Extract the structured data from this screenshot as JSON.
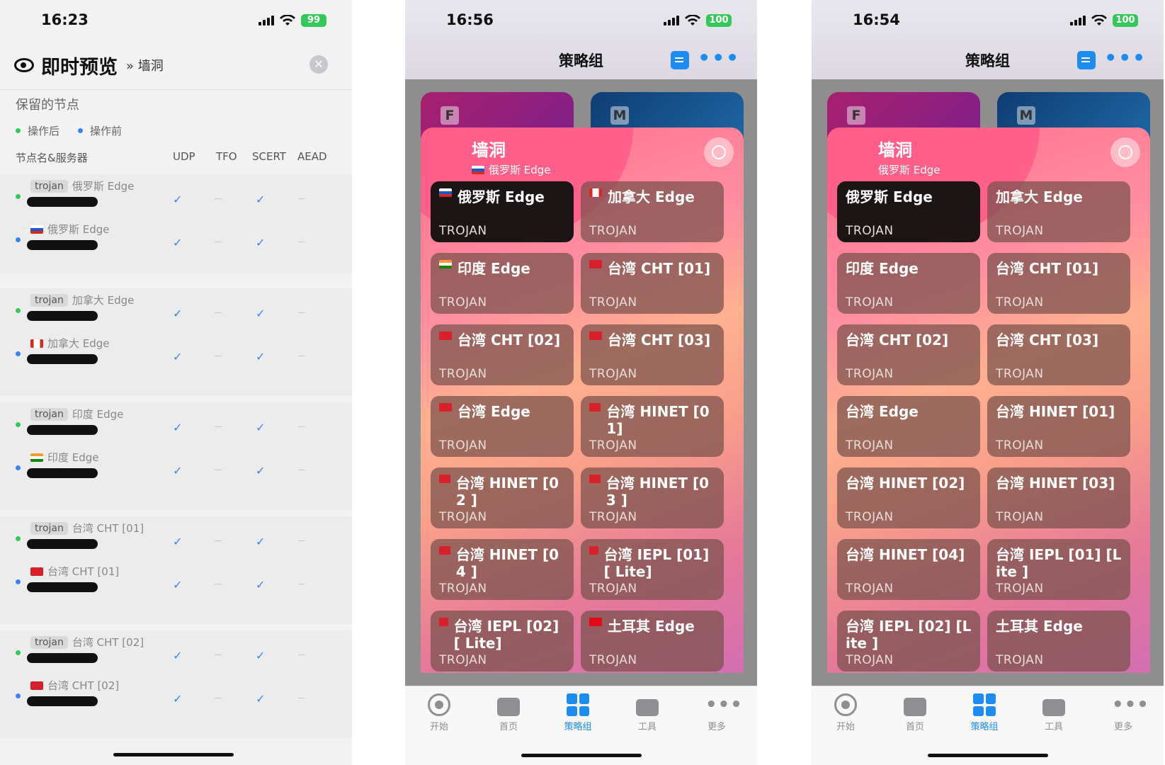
{
  "phone1": {
    "time": "16:23",
    "battery": "99",
    "title": "即时预览",
    "breadcrumb": "墙洞",
    "section": "保留的节点",
    "legend_after": "操作后",
    "legend_before": "操作前",
    "columns": [
      "节点名&服务器",
      "UDP",
      "TFO",
      "SCERT",
      "AEAD"
    ],
    "tag": "trojan",
    "groups": [
      {
        "name": "俄罗斯 Edge",
        "flag": "ru"
      },
      {
        "name": "加拿大 Edge",
        "flag": "ca"
      },
      {
        "name": "印度 Edge",
        "flag": "in"
      },
      {
        "name": "台湾 CHT [01]",
        "flag": "tw"
      },
      {
        "name": "台湾 CHT [02]",
        "flag": "tw"
      }
    ]
  },
  "phone2": {
    "time": "16:56",
    "battery": "100",
    "title": "策略组",
    "bg_letters": [
      "F",
      "M"
    ],
    "group_name": "墙洞",
    "group_sub": "俄罗斯 Edge",
    "nodes": [
      {
        "name": "俄罗斯 Edge",
        "type": "TROJAN",
        "flag": "ru",
        "selected": true
      },
      {
        "name": "加拿大 Edge",
        "type": "TROJAN",
        "flag": "ca"
      },
      {
        "name": "印度 Edge",
        "type": "TROJAN",
        "flag": "in"
      },
      {
        "name": "台湾 CHT [01]",
        "type": "TROJAN",
        "flag": "tw"
      },
      {
        "name": "台湾 CHT [02]",
        "type": "TROJAN",
        "flag": "tw"
      },
      {
        "name": "台湾 CHT [03]",
        "type": "TROJAN",
        "flag": "tw"
      },
      {
        "name": "台湾 Edge",
        "type": "TROJAN",
        "flag": "tw"
      },
      {
        "name": "台湾 HINET [01]",
        "type": "TROJAN",
        "flag": "tw"
      },
      {
        "name": "台湾 HINET [02 ]",
        "type": "TROJAN",
        "flag": "tw"
      },
      {
        "name": "台湾 HINET [03 ]",
        "type": "TROJAN",
        "flag": "tw"
      },
      {
        "name": "台湾 HINET [04 ]",
        "type": "TROJAN",
        "flag": "tw"
      },
      {
        "name": "台湾 IEPL [01] [ Lite]",
        "type": "TROJAN",
        "flag": "tw"
      },
      {
        "name": "台湾 IEPL [02] [ Lite]",
        "type": "TROJAN",
        "flag": "tw"
      },
      {
        "name": "土耳其 Edge",
        "type": "TROJAN",
        "flag": "tr"
      }
    ]
  },
  "phone3": {
    "time": "16:54",
    "battery": "100",
    "title": "策略组",
    "bg_letters": [
      "F",
      "M"
    ],
    "group_name": "墙洞",
    "group_sub": "俄罗斯 Edge",
    "nodes": [
      {
        "name": "俄罗斯 Edge",
        "type": "TROJAN",
        "selected": true
      },
      {
        "name": "加拿大 Edge",
        "type": "TROJAN"
      },
      {
        "name": "印度 Edge",
        "type": "TROJAN"
      },
      {
        "name": "台湾 CHT [01]",
        "type": "TROJAN"
      },
      {
        "name": "台湾 CHT [02]",
        "type": "TROJAN"
      },
      {
        "name": "台湾 CHT [03]",
        "type": "TROJAN"
      },
      {
        "name": "台湾 Edge",
        "type": "TROJAN"
      },
      {
        "name": "台湾 HINET [01]",
        "type": "TROJAN"
      },
      {
        "name": "台湾 HINET [02]",
        "type": "TROJAN"
      },
      {
        "name": "台湾 HINET [03]",
        "type": "TROJAN"
      },
      {
        "name": "台湾 HINET [04]",
        "type": "TROJAN"
      },
      {
        "name": "台湾 IEPL [01] [Lite ]",
        "type": "TROJAN"
      },
      {
        "name": "台湾 IEPL [02] [Lite ]",
        "type": "TROJAN"
      },
      {
        "name": "土耳其 Edge",
        "type": "TROJAN"
      }
    ]
  },
  "tabs": [
    {
      "label": "开始",
      "icon": "record-icon"
    },
    {
      "label": "首页",
      "icon": "stack-icon"
    },
    {
      "label": "策略组",
      "icon": "grid-icon",
      "active": true
    },
    {
      "label": "工具",
      "icon": "toolbox-icon"
    },
    {
      "label": "更多",
      "icon": "more-dots-icon"
    }
  ],
  "colors": {
    "accent": "#1d8cf0",
    "check": "#3b82f6",
    "green": "#34c759",
    "selected_node": "#1b1516"
  }
}
